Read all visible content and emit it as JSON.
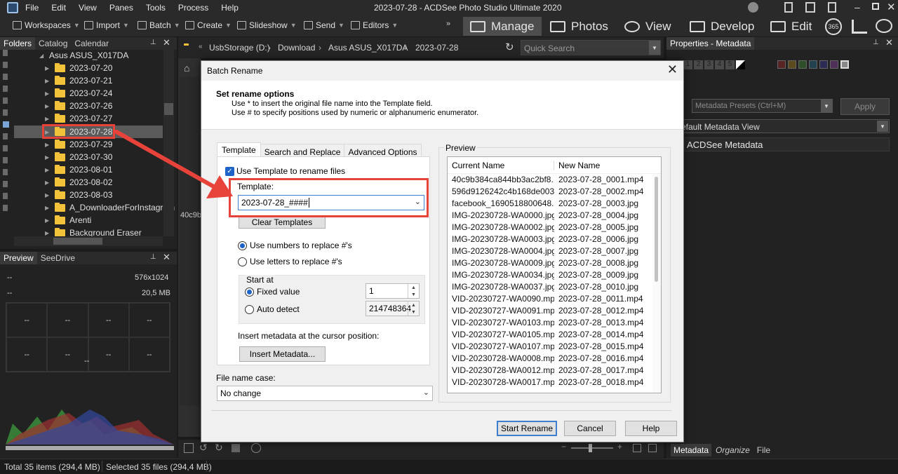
{
  "app": {
    "window_title": "2023-07-28 - ACDSee Photo Studio Ultimate 2020",
    "menu": [
      "File",
      "Edit",
      "View",
      "Panes",
      "Tools",
      "Process",
      "Help"
    ]
  },
  "toolbar": {
    "items": [
      "Workspaces",
      "Import",
      "Batch",
      "Create",
      "Slideshow",
      "Send",
      "Editors"
    ],
    "modes": [
      "Manage",
      "Photos",
      "View",
      "Develop",
      "Edit"
    ],
    "badge_365": "365"
  },
  "left_panel": {
    "tabs": [
      "Folders",
      "Catalog",
      "Calendar"
    ],
    "device": "Asus ASUS_X017DA",
    "folders": [
      "2023-07-20",
      "2023-07-21",
      "2023-07-24",
      "2023-07-26",
      "2023-07-27",
      "2023-07-28",
      "2023-07-29",
      "2023-07-30",
      "2023-08-01",
      "2023-08-02",
      "2023-08-03",
      "A_DownloaderForInstagram",
      "Arenti",
      "Background Eraser"
    ],
    "selected_folder": "2023-07-28"
  },
  "preview_panel": {
    "tabs": [
      "Preview",
      "SeeDrive"
    ],
    "dims": "576x1024",
    "size": "20,5 MB",
    "placeholder": "--"
  },
  "address_bar": {
    "path": [
      "UsbStorage (D:)",
      "Download",
      "Asus ASUS_X017DA",
      "2023-07-28"
    ],
    "quick_search_placeholder": "Quick Search",
    "thumb_fragment": "40c9b"
  },
  "right_panel": {
    "title": "Properties - Metadata",
    "rating_numbers": [
      "1",
      "2",
      "3",
      "4",
      "5"
    ],
    "label_colors": [
      "#5a2424",
      "#5a4a1e",
      "#2f4f2a",
      "#22424f",
      "#2b2b55",
      "#503058"
    ],
    "metadata_presets_placeholder": "Metadata Presets (Ctrl+M)",
    "apply_label": "Apply",
    "view_select": "efault Metadata View",
    "section": "ACDSee Metadata",
    "bottom_tabs": [
      "Metadata",
      "Organize",
      "File"
    ]
  },
  "status_bar": {
    "total": "Total 35 items  (294,4 MB)",
    "selected": "Selected 35 files (294,4 MB)"
  },
  "dialog": {
    "title": "Batch Rename",
    "heading": "Set rename options",
    "hint1": "Use * to insert the original file name into the Template field.",
    "hint2": "Use # to specify positions used by numeric or alphanumeric enumerator.",
    "tabs": [
      "Template",
      "Search and Replace",
      "Advanced Options"
    ],
    "use_template_label": "Use Template to rename files",
    "template_label": "Template:",
    "template_value": "2023-07-28_####",
    "clear_templates": "Clear Templates",
    "radio_numbers": "Use numbers to replace #'s",
    "radio_letters": "Use letters to replace #'s",
    "start_at": "Start at",
    "fixed_value": "Fixed value",
    "fixed_value_number": "1",
    "auto_detect": "Auto detect",
    "auto_detect_number": "214748364",
    "insert_metadata_label": "Insert metadata at the cursor position:",
    "insert_metadata_button": "Insert Metadata...",
    "file_name_case_label": "File name case:",
    "file_name_case_value": "No change",
    "preview_label": "Preview",
    "preview_columns": [
      "Current Name",
      "New Name"
    ],
    "preview_rows": [
      [
        "40c9b384ca844bb3ac2bf8...",
        "2023-07-28_0001.mp4"
      ],
      [
        "596d9126242c4b168de003...",
        "2023-07-28_0002.mp4"
      ],
      [
        "facebook_1690518800648...",
        "2023-07-28_0003.jpg"
      ],
      [
        "IMG-20230728-WA0000.jpg",
        "2023-07-28_0004.jpg"
      ],
      [
        "IMG-20230728-WA0002.jpg",
        "2023-07-28_0005.jpg"
      ],
      [
        "IMG-20230728-WA0003.jpg",
        "2023-07-28_0006.jpg"
      ],
      [
        "IMG-20230728-WA0004.jpg",
        "2023-07-28_0007.jpg"
      ],
      [
        "IMG-20230728-WA0009.jpg",
        "2023-07-28_0008.jpg"
      ],
      [
        "IMG-20230728-WA0034.jpg",
        "2023-07-28_0009.jpg"
      ],
      [
        "IMG-20230728-WA0037.jpg",
        "2023-07-28_0010.jpg"
      ],
      [
        "VID-20230727-WA0090.mp4",
        "2023-07-28_0011.mp4"
      ],
      [
        "VID-20230727-WA0091.mp4",
        "2023-07-28_0012.mp4"
      ],
      [
        "VID-20230727-WA0103.mp4",
        "2023-07-28_0013.mp4"
      ],
      [
        "VID-20230727-WA0105.mp4",
        "2023-07-28_0014.mp4"
      ],
      [
        "VID-20230727-WA0107.mp4",
        "2023-07-28_0015.mp4"
      ],
      [
        "VID-20230728-WA0008.mp4",
        "2023-07-28_0016.mp4"
      ],
      [
        "VID-20230728-WA0012.mp4",
        "2023-07-28_0017.mp4"
      ],
      [
        "VID-20230728-WA0017.mp4",
        "2023-07-28_0018.mp4"
      ]
    ],
    "start_rename": "Start Rename",
    "cancel": "Cancel",
    "help": "Help"
  },
  "annotation_color": "#e8433b"
}
